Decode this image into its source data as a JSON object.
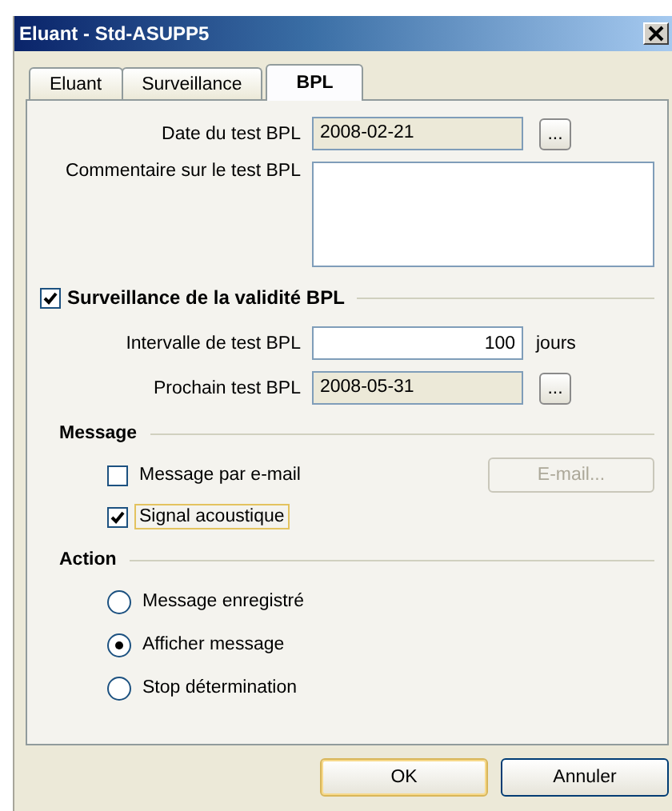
{
  "window": {
    "title": "Eluant - Std-ASUPP5"
  },
  "tabs": [
    {
      "label": "Eluant",
      "selected": false
    },
    {
      "label": "Surveillance",
      "selected": false
    },
    {
      "label": "BPL",
      "selected": true
    }
  ],
  "test_date": {
    "label": "Date du test BPL",
    "value": "2008-02-21",
    "picker": "..."
  },
  "comment": {
    "label": "Commentaire sur le test BPL"
  },
  "validity": {
    "label": "Surveillance de la validité BPL",
    "checked": true
  },
  "interval": {
    "label": "Intervalle de test BPL",
    "value": "100",
    "unit": "jours"
  },
  "next_test": {
    "label": "Prochain test BPL",
    "value": "2008-05-31",
    "picker": "..."
  },
  "message": {
    "title": "Message",
    "options": [
      {
        "label": "Message par e-mail",
        "checked": false,
        "focused": false
      },
      {
        "label": "Signal acoustique",
        "checked": true,
        "focused": true
      }
    ],
    "email_button": {
      "label": "E-mail...",
      "disabled": true
    }
  },
  "action": {
    "title": "Action",
    "options": [
      {
        "label": "Message enregistré",
        "selected": false
      },
      {
        "label": "Afficher message",
        "selected": true
      },
      {
        "label": "Stop détermination",
        "selected": false
      }
    ]
  },
  "buttons": [
    {
      "label": "OK",
      "default": true
    },
    {
      "label": "Annuler",
      "default": false
    }
  ]
}
